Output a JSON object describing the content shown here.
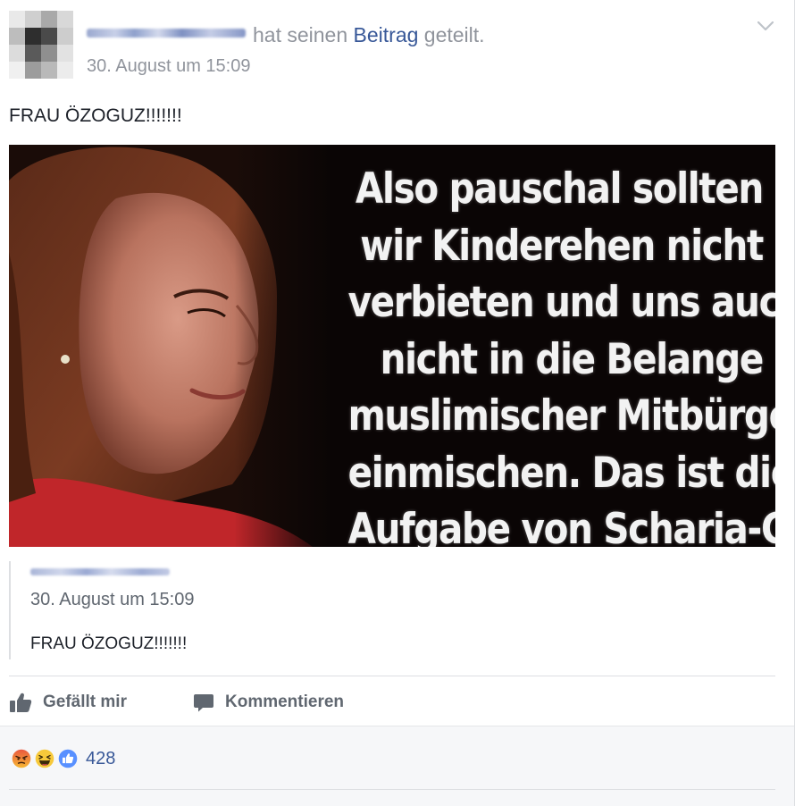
{
  "header": {
    "action_text": "hat seinen",
    "link_text": "Beitrag",
    "action_suffix": "geteilt.",
    "timestamp": "30. August um 15:09"
  },
  "post": {
    "text": "FRAU ÖZOGUZ!!!!!!!",
    "image_caption_lines": [
      "Also pauschal sollten",
      "wir Kinderehen nicht",
      "verbieten und uns auch",
      "nicht in die Belange",
      "muslimischer Mitbürger",
      "einmischen. Das ist die",
      "Aufgabe von Scharia-Gerichten."
    ]
  },
  "shared_original": {
    "timestamp": "30. August um 15:09",
    "text": "FRAU ÖZOGUZ!!!!!!!"
  },
  "actions": {
    "like_label": "Gefällt mir",
    "comment_label": "Kommentieren"
  },
  "reactions": {
    "types": [
      "angry-icon",
      "haha-icon",
      "like-icon"
    ],
    "count": "428"
  },
  "colors": {
    "link": "#385898",
    "meta_text": "#90949c",
    "like_blue": "#5890ff"
  }
}
